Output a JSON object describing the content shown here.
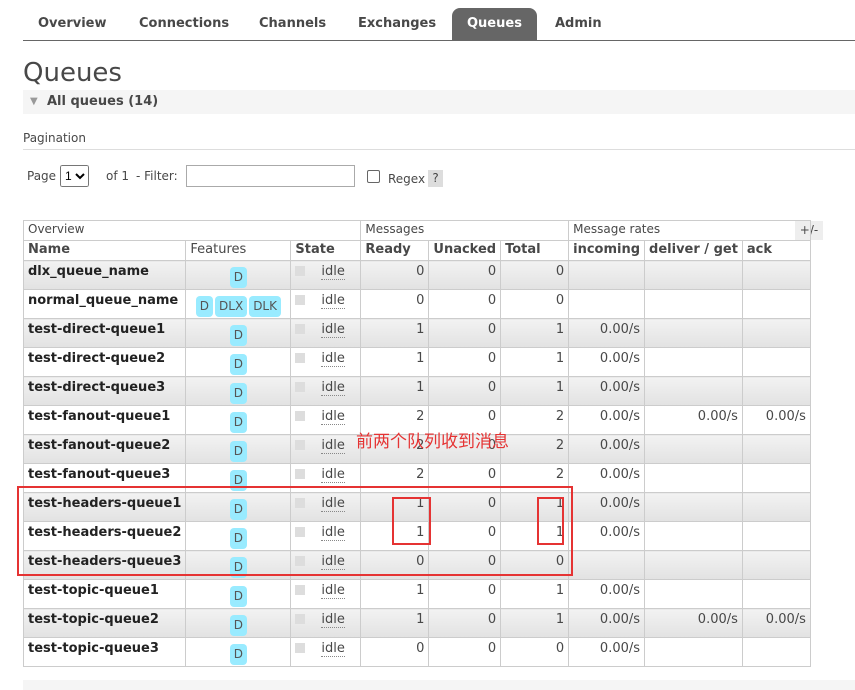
{
  "nav": {
    "tabs": [
      "Overview",
      "Connections",
      "Channels",
      "Exchanges",
      "Queues",
      "Admin"
    ],
    "active": "Queues"
  },
  "page_title": "Queues",
  "section_label": "All queues (14)",
  "pagination": {
    "label": "Pagination",
    "page_label": "Page",
    "page_value": "1",
    "of_label": "of 1",
    "filter_label": "- Filter:",
    "filter_value": "",
    "regex_label": "Regex",
    "help": "?"
  },
  "table": {
    "groups": [
      "Overview",
      "Messages",
      "Message rates"
    ],
    "columns": [
      "Name",
      "Features",
      "State",
      "Ready",
      "Unacked",
      "Total",
      "incoming",
      "deliver / get",
      "ack"
    ],
    "toggle": "+/-",
    "rows": [
      {
        "name": "dlx_queue_name",
        "features": [
          "D"
        ],
        "state": "idle",
        "ready": "0",
        "unacked": "0",
        "total": "0",
        "incoming": "",
        "deliver": "",
        "ack": ""
      },
      {
        "name": "normal_queue_name",
        "features": [
          "D",
          "DLX",
          "DLK"
        ],
        "state": "idle",
        "ready": "0",
        "unacked": "0",
        "total": "0",
        "incoming": "",
        "deliver": "",
        "ack": ""
      },
      {
        "name": "test-direct-queue1",
        "features": [
          "D"
        ],
        "state": "idle",
        "ready": "1",
        "unacked": "0",
        "total": "1",
        "incoming": "0.00/s",
        "deliver": "",
        "ack": ""
      },
      {
        "name": "test-direct-queue2",
        "features": [
          "D"
        ],
        "state": "idle",
        "ready": "1",
        "unacked": "0",
        "total": "1",
        "incoming": "0.00/s",
        "deliver": "",
        "ack": ""
      },
      {
        "name": "test-direct-queue3",
        "features": [
          "D"
        ],
        "state": "idle",
        "ready": "1",
        "unacked": "0",
        "total": "1",
        "incoming": "0.00/s",
        "deliver": "",
        "ack": ""
      },
      {
        "name": "test-fanout-queue1",
        "features": [
          "D"
        ],
        "state": "idle",
        "ready": "2",
        "unacked": "0",
        "total": "2",
        "incoming": "0.00/s",
        "deliver": "0.00/s",
        "ack": "0.00/s"
      },
      {
        "name": "test-fanout-queue2",
        "features": [
          "D"
        ],
        "state": "idle",
        "ready": "2",
        "unacked": "0",
        "total": "2",
        "incoming": "0.00/s",
        "deliver": "",
        "ack": ""
      },
      {
        "name": "test-fanout-queue3",
        "features": [
          "D"
        ],
        "state": "idle",
        "ready": "2",
        "unacked": "0",
        "total": "2",
        "incoming": "0.00/s",
        "deliver": "",
        "ack": ""
      },
      {
        "name": "test-headers-queue1",
        "features": [
          "D"
        ],
        "state": "idle",
        "ready": "1",
        "unacked": "0",
        "total": "1",
        "incoming": "0.00/s",
        "deliver": "",
        "ack": ""
      },
      {
        "name": "test-headers-queue2",
        "features": [
          "D"
        ],
        "state": "idle",
        "ready": "1",
        "unacked": "0",
        "total": "1",
        "incoming": "0.00/s",
        "deliver": "",
        "ack": ""
      },
      {
        "name": "test-headers-queue3",
        "features": [
          "D"
        ],
        "state": "idle",
        "ready": "0",
        "unacked": "0",
        "total": "0",
        "incoming": "",
        "deliver": "",
        "ack": ""
      },
      {
        "name": "test-topic-queue1",
        "features": [
          "D"
        ],
        "state": "idle",
        "ready": "1",
        "unacked": "0",
        "total": "1",
        "incoming": "0.00/s",
        "deliver": "",
        "ack": ""
      },
      {
        "name": "test-topic-queue2",
        "features": [
          "D"
        ],
        "state": "idle",
        "ready": "1",
        "unacked": "0",
        "total": "1",
        "incoming": "0.00/s",
        "deliver": "0.00/s",
        "ack": "0.00/s"
      },
      {
        "name": "test-topic-queue3",
        "features": [
          "D"
        ],
        "state": "idle",
        "ready": "0",
        "unacked": "0",
        "total": "0",
        "incoming": "0.00/s",
        "deliver": "",
        "ack": ""
      }
    ]
  },
  "annotation": {
    "text": "前两个队列收到消息",
    "color": "#e53333"
  },
  "colors": {
    "active_tab": "#666666",
    "feature_badge": "#99ebff"
  }
}
